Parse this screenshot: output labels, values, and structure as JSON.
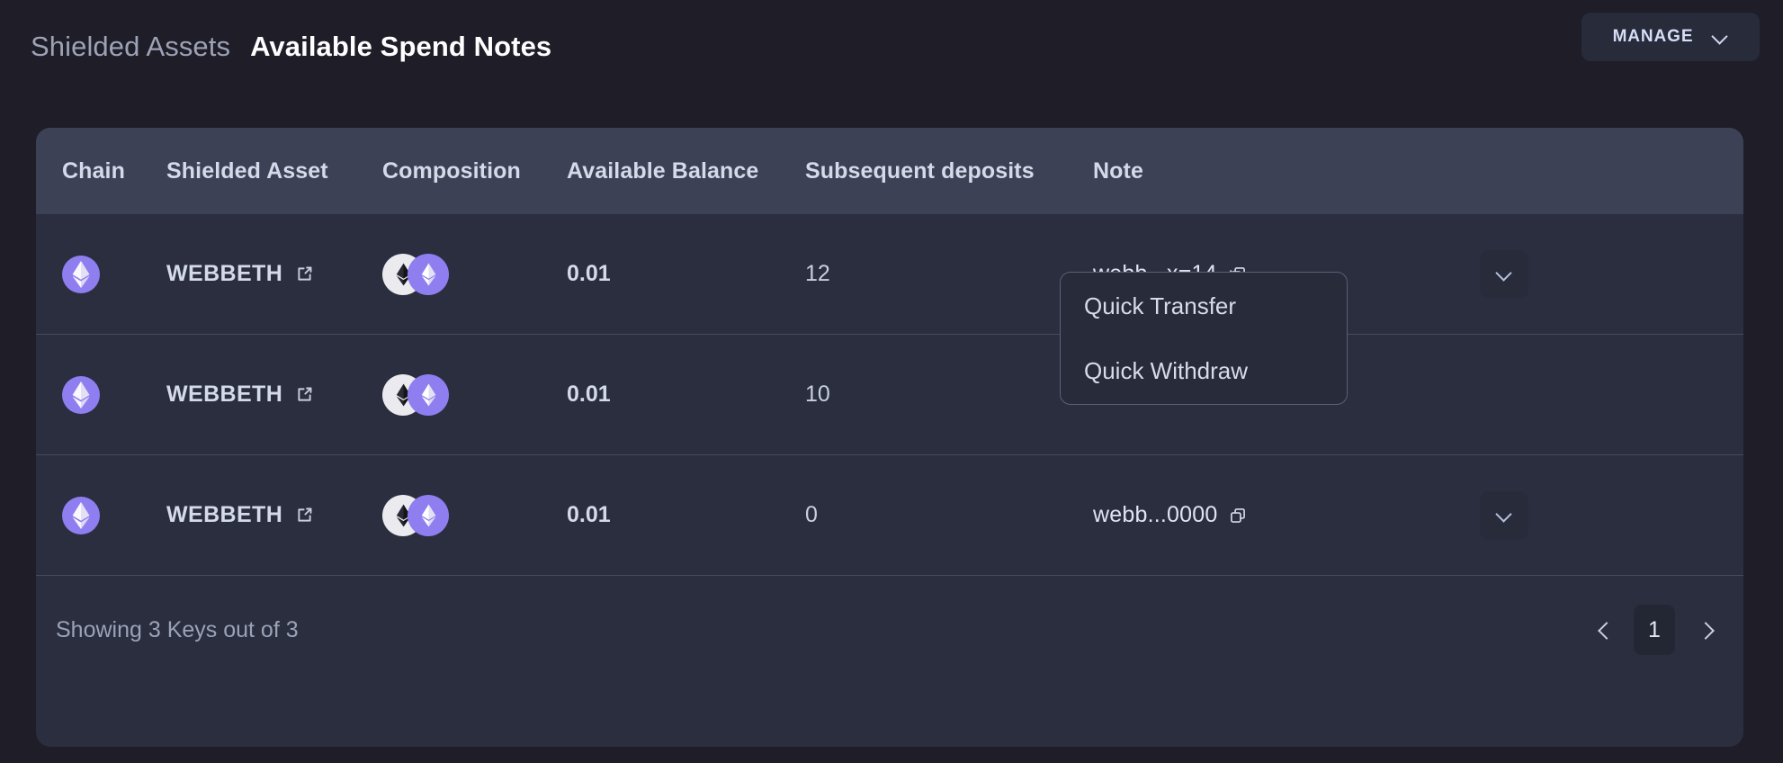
{
  "header": {
    "breadcrumb_parent": "Shielded Assets",
    "breadcrumb_current": "Available Spend Notes",
    "manage_label": "MANAGE",
    "manage_chevron_icon": "chevron-down-icon"
  },
  "table": {
    "columns": [
      "Chain",
      "Shielded Asset",
      "Composition",
      "Available Balance",
      "Subsequent deposits",
      "Note"
    ],
    "rows": [
      {
        "chain_icon": "ethereum-token-icon",
        "asset": "WEBBETH",
        "asset_link_icon": "external-link-icon",
        "composition": [
          "eth-token-icon",
          "webbeth-token-icon"
        ],
        "balance": "0.01",
        "deposits": "12",
        "note": "webb...x=14",
        "note_copy_icon": "copy-icon",
        "menu_icon": "chevron-down-icon"
      },
      {
        "chain_icon": "ethereum-token-icon",
        "asset": "WEBBETH",
        "asset_link_icon": "external-link-icon",
        "composition": [
          "eth-token-icon",
          "webbeth-token-icon"
        ],
        "balance": "0.01",
        "deposits": "10",
        "note": "",
        "note_copy_icon": "copy-icon",
        "menu_icon": "chevron-down-icon"
      },
      {
        "chain_icon": "ethereum-token-icon",
        "asset": "WEBBETH",
        "asset_link_icon": "external-link-icon",
        "composition": [
          "eth-token-icon",
          "webbeth-token-icon"
        ],
        "balance": "0.01",
        "deposits": "0",
        "note": "webb...0000",
        "note_copy_icon": "copy-icon",
        "menu_icon": "chevron-down-icon"
      }
    ]
  },
  "dropdown": {
    "items": [
      "Quick Transfer",
      "Quick Withdraw"
    ]
  },
  "footer": {
    "showing_text": "Showing 3 Keys out of 3",
    "prev_icon": "chevron-left-icon",
    "next_icon": "chevron-right-icon",
    "current_page": "1"
  },
  "colors": {
    "page_background": "#1e1d28",
    "card_background": "#2a2e3f",
    "table_header_background": "#3c4155",
    "accent_purple": "#8f7ef0",
    "button_background": "#272b3a",
    "row_divider": "#454b60",
    "text_primary": "#d4dae9",
    "text_muted": "#9ba3b8"
  }
}
